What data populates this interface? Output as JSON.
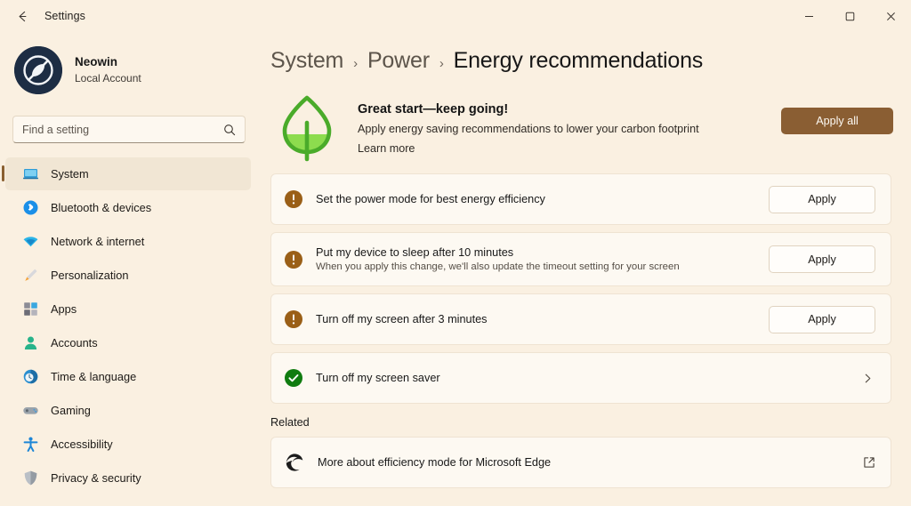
{
  "window": {
    "title": "Settings",
    "back_icon": "arrow-left-icon",
    "minimize_label": "Minimize",
    "maximize_label": "Maximize",
    "close_label": "Close"
  },
  "account": {
    "name": "Neowin",
    "type": "Local Account",
    "avatar_icon": "user-avatar"
  },
  "search": {
    "placeholder": "Find a setting",
    "value": "",
    "icon": "search-icon"
  },
  "sidebar": {
    "items": [
      {
        "label": "System",
        "icon": "system-icon",
        "selected": true
      },
      {
        "label": "Bluetooth & devices",
        "icon": "bluetooth-icon",
        "selected": false
      },
      {
        "label": "Network & internet",
        "icon": "network-icon",
        "selected": false
      },
      {
        "label": "Personalization",
        "icon": "personalization-icon",
        "selected": false
      },
      {
        "label": "Apps",
        "icon": "apps-icon",
        "selected": false
      },
      {
        "label": "Accounts",
        "icon": "accounts-icon",
        "selected": false
      },
      {
        "label": "Time & language",
        "icon": "time-language-icon",
        "selected": false
      },
      {
        "label": "Gaming",
        "icon": "gaming-icon",
        "selected": false
      },
      {
        "label": "Accessibility",
        "icon": "accessibility-icon",
        "selected": false
      },
      {
        "label": "Privacy & security",
        "icon": "privacy-security-icon",
        "selected": false
      }
    ]
  },
  "breadcrumb": {
    "root": "System",
    "parent": "Power",
    "current": "Energy recommendations",
    "separator": "›"
  },
  "hero": {
    "icon": "leaf-icon",
    "title": "Great start—keep going!",
    "description": "Apply energy saving recommendations to lower your carbon footprint",
    "link": "Learn more",
    "apply_all_label": "Apply all"
  },
  "recommendations": [
    {
      "status_icon": "warning-icon",
      "title": "Set the power mode for best energy efficiency",
      "subtitle": "",
      "action": "Apply",
      "action_type": "button"
    },
    {
      "status_icon": "warning-icon",
      "title": "Put my device to sleep after 10 minutes",
      "subtitle": "When you apply this change, we'll also update the timeout setting for your screen",
      "action": "Apply",
      "action_type": "button"
    },
    {
      "status_icon": "warning-icon",
      "title": "Turn off my screen after 3 minutes",
      "subtitle": "",
      "action": "Apply",
      "action_type": "button"
    },
    {
      "status_icon": "success-check-icon",
      "title": "Turn off my screen saver",
      "subtitle": "",
      "action": "",
      "action_type": "chevron"
    }
  ],
  "related": {
    "heading": "Related",
    "items": [
      {
        "icon": "microsoft-edge-icon",
        "label": "More about efficiency mode for Microsoft Edge",
        "trailing_icon": "external-link-icon"
      }
    ]
  },
  "colors": {
    "page_background": "#faf0e1",
    "card_background": "#fdf9f2",
    "accent": "#8a5e33",
    "warning": "#9a5f17",
    "success": "#107c10",
    "leaf_green": "#4aab2a"
  }
}
